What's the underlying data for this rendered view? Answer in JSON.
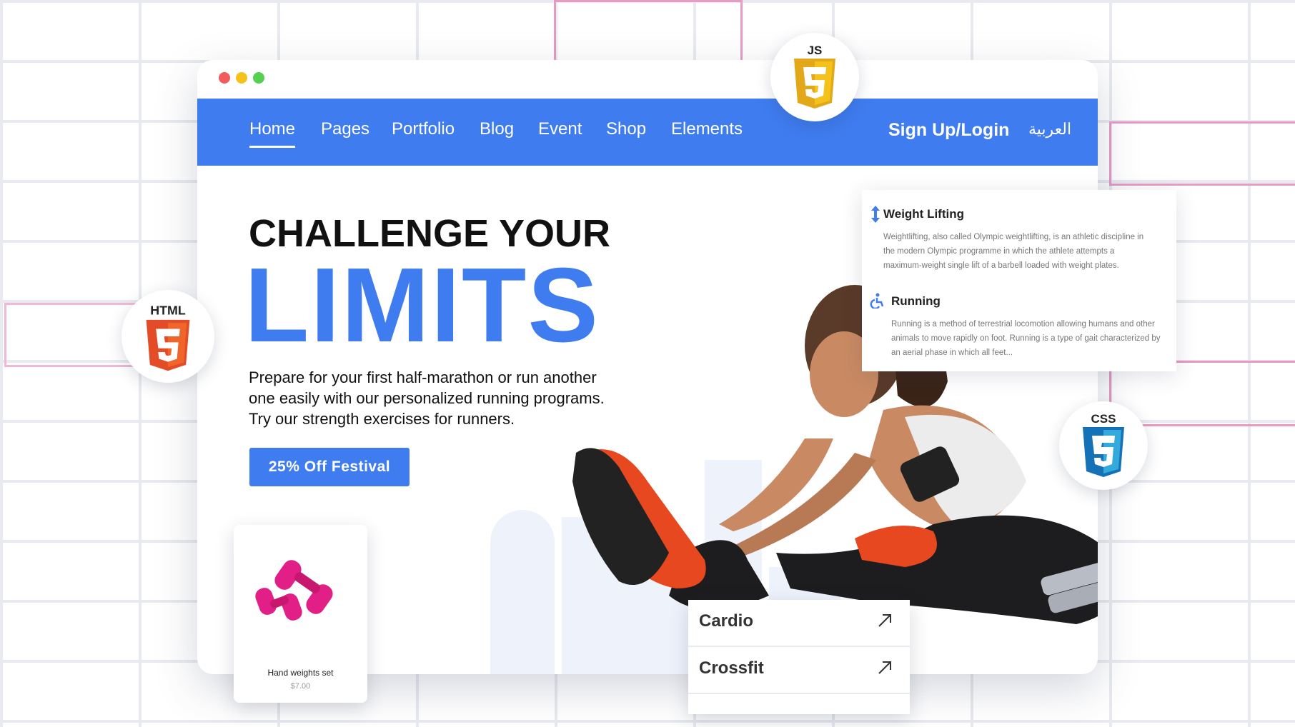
{
  "nav": {
    "items": [
      {
        "label": "Home",
        "active": true
      },
      {
        "label": "Pages"
      },
      {
        "label": "Portfolio"
      },
      {
        "label": "Blog"
      },
      {
        "label": "Event"
      },
      {
        "label": "Shop"
      },
      {
        "label": "Elements"
      }
    ],
    "login": "Sign Up/Login",
    "language": "العربية"
  },
  "hero": {
    "title_line1": "CHALLENGE YOUR",
    "title_line2": "LIMITS",
    "description": "Prepare for your first half-marathon or run another one easily with our personalized running programs. Try our strength exercises for runners.",
    "cta_label": "25% Off Festival"
  },
  "info_card": {
    "items": [
      {
        "title": "Weight Lifting",
        "icon": "vertical-arrows-icon",
        "text": "Weightlifting, also called Olympic weightlifting, is an athletic discipline in the modern Olympic programme in which the athlete attempts a maximum-weight single lift of a barbell loaded with weight plates."
      },
      {
        "title": "Running",
        "icon": "accessibility-icon",
        "text": "Running is a method of terrestrial locomotion allowing humans and other animals to move rapidly on foot. Running is a type of gait characterized by an aerial phase in which all feet..."
      }
    ]
  },
  "product": {
    "name": "Hand weights set",
    "price": "$7.00"
  },
  "categories": [
    {
      "label": "Cardio",
      "icon": "arrow-up-right-icon"
    },
    {
      "label": "Crossfit",
      "icon": "arrow-up-right-icon"
    }
  ],
  "badges": {
    "js": "JS",
    "html": "HTML",
    "css": "CSS"
  },
  "colors": {
    "brand_blue": "#3f7cf0",
    "dumbbell_pink": "#e21f86",
    "shoe_orange": "#e8481f"
  }
}
